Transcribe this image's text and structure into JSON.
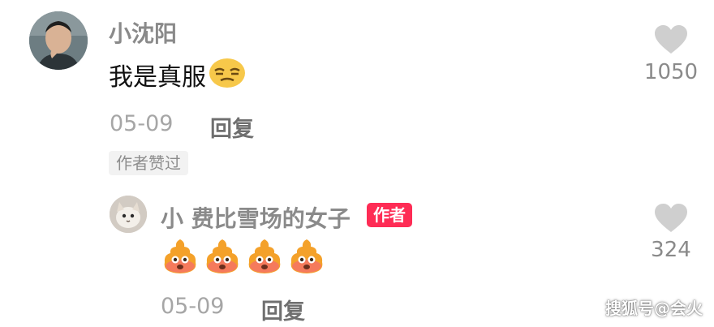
{
  "main_comment": {
    "username": "小沈阳",
    "text": "我是真服",
    "text_emoji": "smirking-face-emoji",
    "date": "05-09",
    "reply_label": "回复",
    "like_count": "1050",
    "liked_by_author_badge": "作者赞过"
  },
  "reply_comment": {
    "username": "小 费比雪场的女子",
    "author_badge": "作者",
    "emojis": [
      "poop-emoji",
      "poop-emoji",
      "poop-emoji",
      "poop-emoji"
    ],
    "date": "05-09",
    "reply_label": "回复",
    "like_count": "324"
  },
  "watermark": "搜狐号@会火",
  "colors": {
    "accent": "#fe2c55",
    "username": "#8a8a8a",
    "meta": "#a6a6a6",
    "heart": "#cfcfcf"
  }
}
